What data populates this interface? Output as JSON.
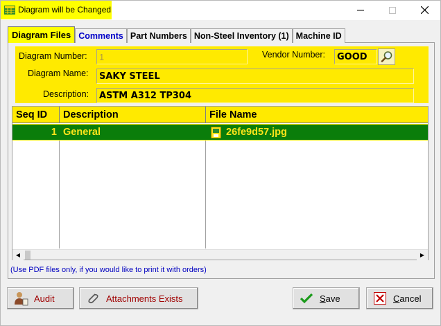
{
  "window": {
    "title": "Diagram will be Changed"
  },
  "tabs": [
    {
      "label": "Diagram Files",
      "active": true
    },
    {
      "label": "Comments",
      "active": false
    },
    {
      "label": "Part Numbers",
      "active": false
    },
    {
      "label": "Non-Steel Inventory (1)",
      "active": false
    },
    {
      "label": "Machine ID",
      "active": false
    }
  ],
  "form": {
    "diagram_number_label": "Diagram Number:",
    "diagram_number_value": "1",
    "vendor_number_label": "Vendor Number:",
    "vendor_number_value": "GOOD",
    "diagram_name_label": "Diagram Name:",
    "diagram_name_value": "SAKY STEEL",
    "description_label": "Description:",
    "description_value": "ASTM A312 TP304"
  },
  "grid": {
    "columns": [
      "Seq ID",
      "Description",
      "File Name"
    ],
    "rows": [
      {
        "seq_id": "1",
        "description": "General",
        "file_name": "26fe9d57.jpg"
      }
    ]
  },
  "hint": "(Use PDF files only, if you would like to print it with orders)",
  "buttons": {
    "audit": "Audit",
    "attachments": "Attachments Exists",
    "save_prefix": "S",
    "save_rest": "ave",
    "cancel_prefix": "C",
    "cancel_rest": "ancel"
  },
  "colors": {
    "accent_yellow": "#ffea00",
    "row_green": "#0a7d0a",
    "row_text": "#ffe51a",
    "hint_blue": "#0000c0"
  },
  "icons": [
    "app-grid-icon",
    "minimize-icon",
    "maximize-icon",
    "close-icon",
    "magnifier-icon",
    "file-icon",
    "audit-person-icon",
    "paperclip-icon",
    "checkmark-icon",
    "cancel-x-icon"
  ]
}
